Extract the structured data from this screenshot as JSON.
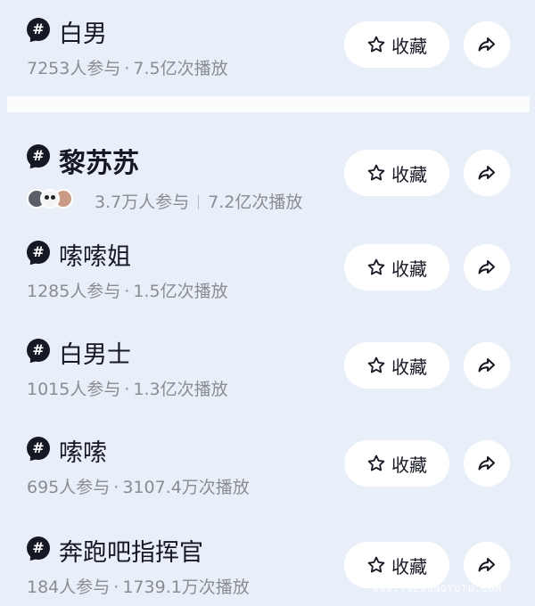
{
  "actions": {
    "favorite_label": "收藏"
  },
  "topics": [
    {
      "title": "白男",
      "participants": "7253人参与",
      "plays": "7.5亿次播放"
    },
    {
      "title": "黎苏苏",
      "participants": "3.7万人参与",
      "plays": "7.2亿次播放"
    },
    {
      "title": "嗦嗦姐",
      "participants": "1285人参与",
      "plays": "1.5亿次播放"
    },
    {
      "title": "白男士",
      "participants": "1015人参与",
      "plays": "1.3亿次播放"
    },
    {
      "title": "嗦嗦",
      "participants": "695人参与",
      "plays": "3107.4万次播放"
    },
    {
      "title": "奔跑吧指挥官",
      "participants": "184人参与",
      "plays": "1739.1万次播放"
    }
  ],
  "separator": "·",
  "watermark": {
    "site": "WWW.YUEGONGYUTU.COM"
  },
  "icons": {
    "hashtag": "hashtag-icon",
    "favorite": "star-outline-icon",
    "share": "share-arrow-icon"
  },
  "colors": {
    "background": "#e9eff8",
    "button": "#ffffff",
    "text": "#161823",
    "meta": "#8a8c93"
  }
}
